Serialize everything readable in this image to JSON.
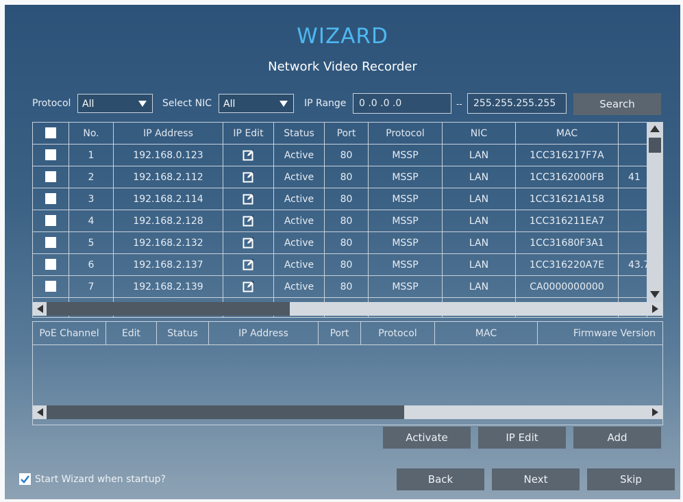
{
  "header": {
    "title": "WIZARD",
    "subtitle": "Network Video Recorder"
  },
  "filters": {
    "protocol_label": "Protocol",
    "protocol_value": "All",
    "nic_label": "Select NIC",
    "nic_value": "All",
    "ip_range_label": "IP Range",
    "ip_from": "0 .0 .0 .0",
    "ip_sep": "--",
    "ip_to": "255.255.255.255",
    "search_label": "Search"
  },
  "device_table": {
    "columns": [
      "No.",
      "IP Address",
      "IP Edit",
      "Status",
      "Port",
      "Protocol",
      "NIC",
      "MAC"
    ],
    "rows": [
      {
        "no": "1",
        "ip": "192.168.0.123",
        "status": "Active",
        "port": "80",
        "protocol": "MSSP",
        "nic": "LAN",
        "mac": "1CC316217F7A",
        "extra": ""
      },
      {
        "no": "2",
        "ip": "192.168.2.112",
        "status": "Active",
        "port": "80",
        "protocol": "MSSP",
        "nic": "LAN",
        "mac": "1CC3162000FB",
        "extra": "41"
      },
      {
        "no": "3",
        "ip": "192.168.2.114",
        "status": "Active",
        "port": "80",
        "protocol": "MSSP",
        "nic": "LAN",
        "mac": "1CC31621A158",
        "extra": ""
      },
      {
        "no": "4",
        "ip": "192.168.2.128",
        "status": "Active",
        "port": "80",
        "protocol": "MSSP",
        "nic": "LAN",
        "mac": "1CC316211EA7",
        "extra": ""
      },
      {
        "no": "5",
        "ip": "192.168.2.132",
        "status": "Active",
        "port": "80",
        "protocol": "MSSP",
        "nic": "LAN",
        "mac": "1CC31680F3A1",
        "extra": ""
      },
      {
        "no": "6",
        "ip": "192.168.2.137",
        "status": "Active",
        "port": "80",
        "protocol": "MSSP",
        "nic": "LAN",
        "mac": "1CC316220A7E",
        "extra": "43.7"
      },
      {
        "no": "7",
        "ip": "192.168.2.139",
        "status": "Active",
        "port": "80",
        "protocol": "MSSP",
        "nic": "LAN",
        "mac": "CA0000000000",
        "extra": ""
      }
    ]
  },
  "poe_table": {
    "columns": [
      "PoE Channel",
      "Edit",
      "Status",
      "IP Address",
      "Port",
      "Protocol",
      "MAC",
      "Firmware Version"
    ]
  },
  "actions": {
    "activate": "Activate",
    "ip_edit": "IP Edit",
    "add": "Add"
  },
  "footer": {
    "startup_label": "Start Wizard when startup?",
    "back": "Back",
    "next": "Next",
    "skip": "Skip"
  },
  "colors": {
    "accent": "#4fb8f0",
    "button": "#5a6570"
  }
}
